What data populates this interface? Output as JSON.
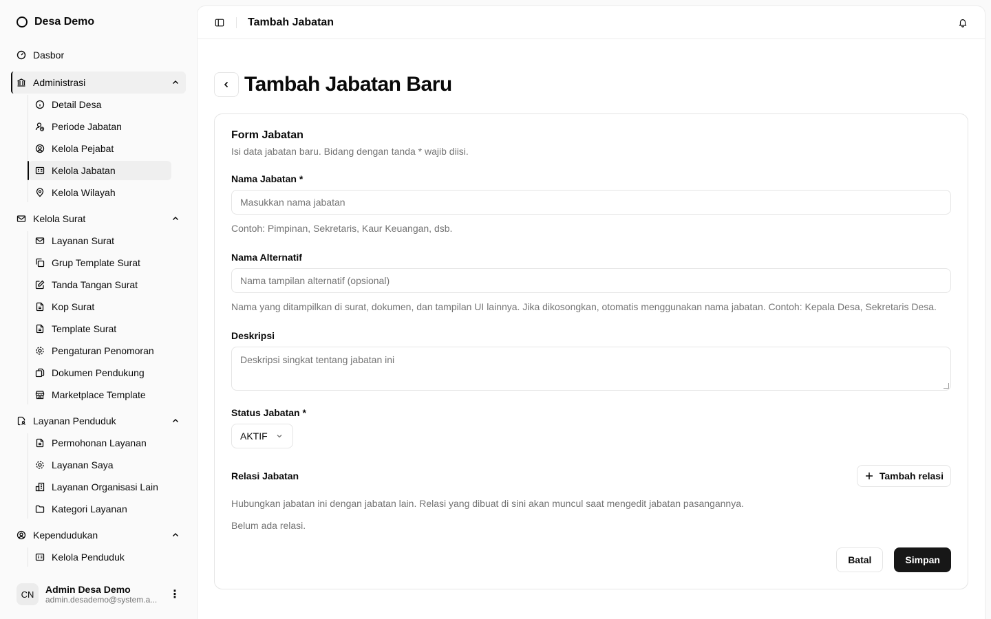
{
  "sidebar": {
    "brand": "Desa Demo",
    "dashboard": "Dasbor",
    "groups": [
      {
        "label": "Administrasi",
        "items": [
          "Detail Desa",
          "Periode Jabatan",
          "Kelola Pejabat",
          "Kelola Jabatan",
          "Kelola Wilayah"
        ]
      },
      {
        "label": "Kelola Surat",
        "items": [
          "Layanan Surat",
          "Grup Template Surat",
          "Tanda Tangan Surat",
          "Kop Surat",
          "Template Surat",
          "Pengaturan Penomoran",
          "Dokumen Pendukung",
          "Marketplace Template"
        ]
      },
      {
        "label": "Layanan Penduduk",
        "items": [
          "Permohonan Layanan",
          "Layanan Saya",
          "Layanan Organisasi Lain",
          "Kategori Layanan"
        ]
      },
      {
        "label": "Kependudukan",
        "items": [
          "Kelola Penduduk"
        ]
      }
    ],
    "user": {
      "initials": "CN",
      "name": "Admin Desa Demo",
      "email": "admin.desademo@system.a..."
    }
  },
  "topbar": {
    "title": "Tambah Jabatan"
  },
  "page": {
    "title": "Tambah Jabatan Baru"
  },
  "form": {
    "title": "Form Jabatan",
    "description": "Isi data jabatan baru. Bidang dengan tanda * wajib diisi.",
    "nama": {
      "label": "Nama Jabatan *",
      "placeholder": "Masukkan nama jabatan",
      "hint": "Contoh: Pimpinan, Sekretaris, Kaur Keuangan, dsb."
    },
    "alternatif": {
      "label": "Nama Alternatif",
      "placeholder": "Nama tampilan alternatif (opsional)",
      "hint": "Nama yang ditampilkan di surat, dokumen, dan tampilan UI lainnya. Jika dikosongkan, otomatis menggunakan nama jabatan. Contoh: Kepala Desa, Sekretaris Desa."
    },
    "deskripsi": {
      "label": "Deskripsi",
      "placeholder": "Deskripsi singkat tentang jabatan ini"
    },
    "status": {
      "label": "Status Jabatan *",
      "value": "AKTIF"
    },
    "relasi": {
      "label": "Relasi Jabatan",
      "add_button": "Tambah relasi",
      "description": "Hubungkan jabatan ini dengan jabatan lain. Relasi yang dibuat di sini akan muncul saat mengedit jabatan pasangannya.",
      "empty": "Belum ada relasi."
    },
    "cancel": "Batal",
    "save": "Simpan"
  }
}
